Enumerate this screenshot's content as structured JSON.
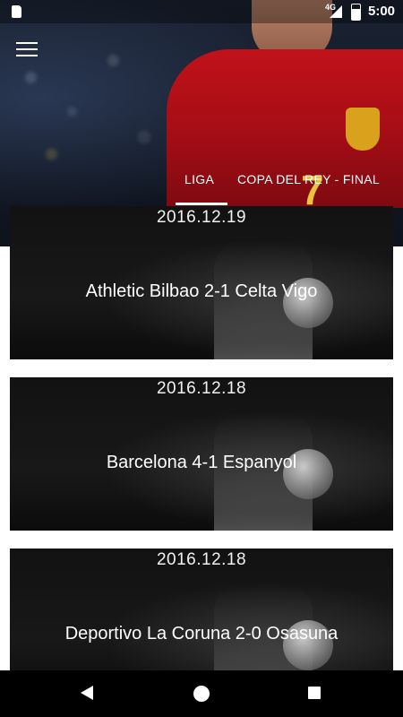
{
  "status_bar": {
    "network": "4G",
    "time": "5:00"
  },
  "header": {
    "menu_icon": "hamburger-menu-icon"
  },
  "tabs": [
    {
      "label": "LIGA",
      "selected": true
    },
    {
      "label": "COPA DEL REY - FINAL",
      "selected": false
    }
  ],
  "matches": [
    {
      "date": "2016.12.19",
      "title": "Athletic Bilbao 2-1 Celta Vigo"
    },
    {
      "date": "2016.12.18",
      "title": "Barcelona 4-1 Espanyol"
    },
    {
      "date": "2016.12.18",
      "title": "Deportivo La Coruna 2-0 Osasuna"
    }
  ],
  "nav_bar": {
    "back_icon": "back-triangle-icon",
    "home_icon": "home-circle-icon",
    "recents_icon": "recents-square-icon"
  },
  "colors": {
    "accent": "#ffffff",
    "jersey_red": "#c1121a",
    "card_bg": "#141414"
  }
}
